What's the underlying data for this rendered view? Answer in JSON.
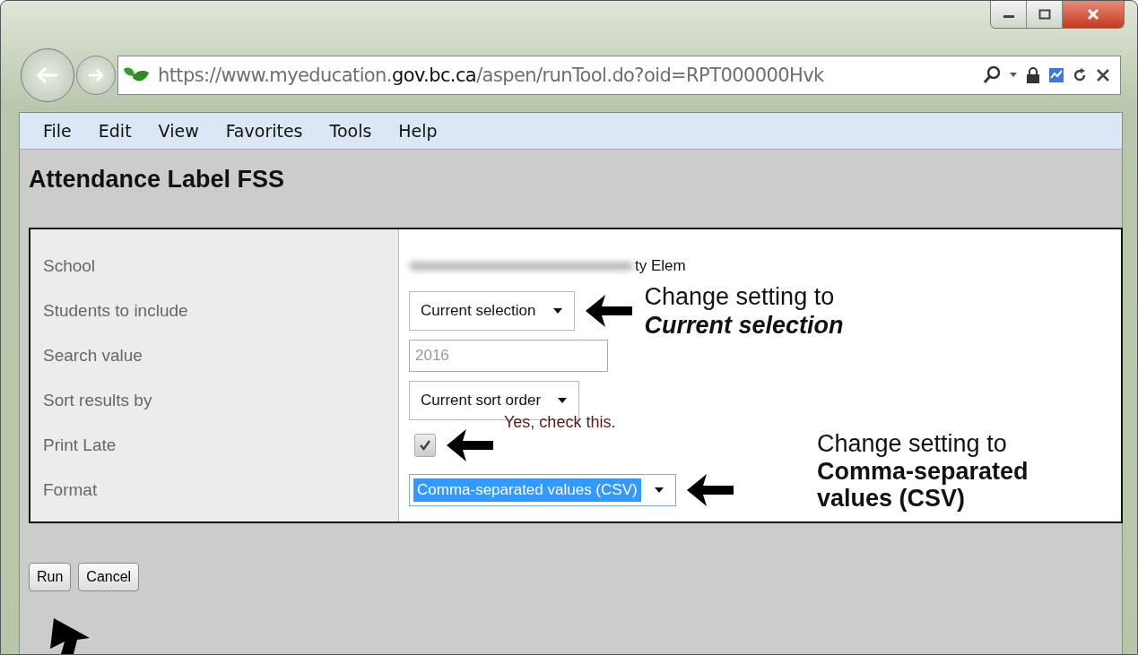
{
  "browser": {
    "url": "https://www.myeducation.**gov.bc.ca**/aspen/runTool.do?oid=RPT000000Hvk"
  },
  "menu": [
    "File",
    "Edit",
    "View",
    "Favorites",
    "Tools",
    "Help"
  ],
  "page": {
    "title": "Attendance Label FSS",
    "fields": [
      {
        "label": "School",
        "kind": "text",
        "value": "ty Elem",
        "blurred": true
      },
      {
        "label": "Students to include",
        "kind": "select",
        "value": "Current selection",
        "highlighted": false,
        "note": {
          "lines": [
            "Change setting to",
            "*Current selection*"
          ]
        }
      },
      {
        "label": "Search value",
        "kind": "input",
        "placeholder": "2016"
      },
      {
        "label": "Sort results by",
        "kind": "select",
        "value": "Current sort order",
        "highlighted": false
      },
      {
        "label": "Print Late",
        "kind": "checkbox",
        "checked": true,
        "hint": "Yes, check this."
      },
      {
        "label": "Format",
        "kind": "select",
        "value": "Comma-separated values (CSV)",
        "highlighted": true,
        "note": {
          "lines": [
            "Change setting to",
            "Comma-separated",
            "values (CSV)"
          ]
        }
      }
    ],
    "buttons": [
      "Run",
      "Cancel"
    ]
  }
}
